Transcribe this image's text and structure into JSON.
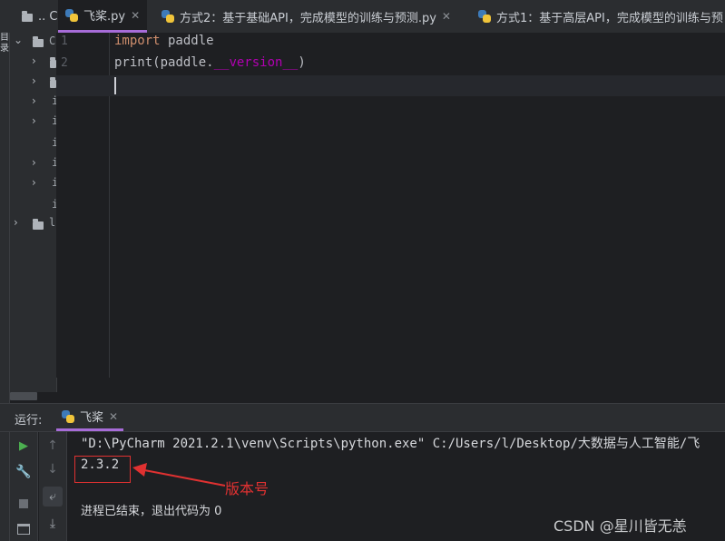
{
  "top_tabs": [
    {
      "label": ".. C",
      "active": false
    },
    {
      "label": "飞桨.py",
      "active": true
    },
    {
      "label": "方式2：基于基础API，完成模型的训练与预测.py",
      "active": false
    },
    {
      "label": "方式1：基于高层API，完成模型的训练与预"
    }
  ],
  "left_strip_label": "目录",
  "tree": {
    "root_label": "C",
    "row_initial": "i",
    "last_label": "l"
  },
  "editor": {
    "line_numbers": [
      "1",
      "2",
      "3"
    ],
    "line1_kw": "import",
    "line1_rest": " paddle",
    "line2_fn": "print",
    "line2_mid": "(paddle.",
    "line2_dunder": "__version__",
    "line2_end": ")"
  },
  "run_panel": {
    "label": "运行:",
    "tab_label": "飞桨",
    "command": "\"D:\\PyCharm 2021.2.1\\venv\\Scripts\\python.exe\" C:/Users/l/Desktop/大数据与人工智能/飞",
    "version": "2.3.2",
    "exit_msg": "进程已结束，退出代码为 0"
  },
  "annotation": {
    "label": "版本号",
    "color": "#e03131"
  },
  "watermark": "CSDN @星川皆无恙",
  "colors": {
    "accent": "#a76cd8",
    "keyword": "#cf8e6d",
    "dunder": "#b200b2",
    "run": "#4caf50"
  }
}
